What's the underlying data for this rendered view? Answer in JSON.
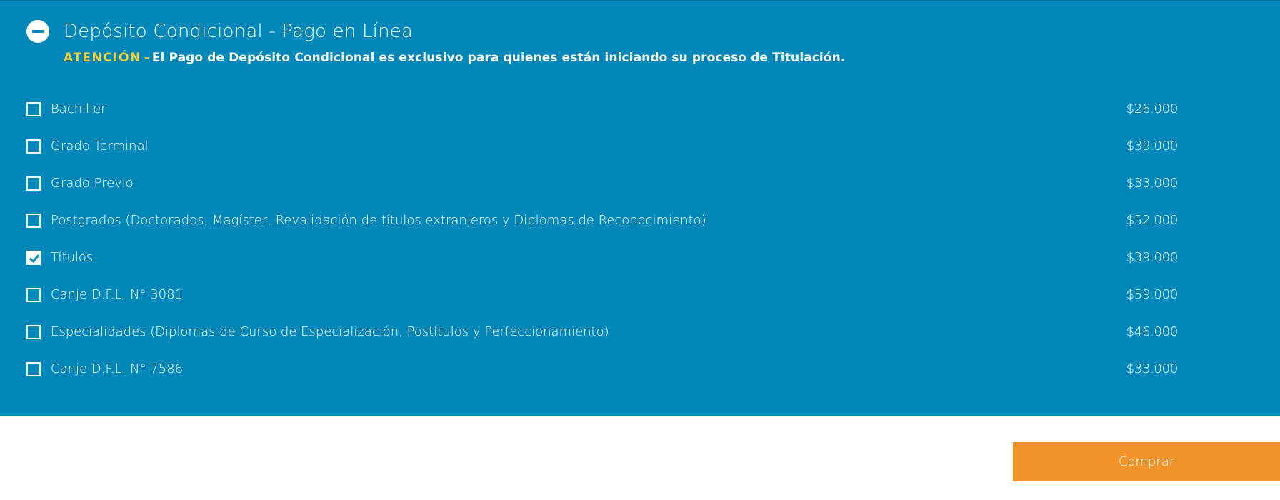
{
  "section": {
    "title": "Depósito Condicional - Pago en Línea",
    "toggle_icon": "minus-circle-icon",
    "notice": {
      "label": "ATENCIÓN",
      "separator": "-",
      "message": "El Pago de Depósito Condicional es exclusivo para quienes están iniciando su proceso de Titulación."
    }
  },
  "options": [
    {
      "label": "Bachiller",
      "price": "$26.000",
      "checked": false
    },
    {
      "label": "Grado Terminal",
      "price": "$39.000",
      "checked": false
    },
    {
      "label": "Grado Previo",
      "price": "$33.000",
      "checked": false
    },
    {
      "label": "Postgrados (Doctorados, Magíster, Revalidación de títulos extranjeros y Diplomas de Reconocimiento)",
      "price": "$52.000",
      "checked": false
    },
    {
      "label": "Títulos",
      "price": "$39.000",
      "checked": true
    },
    {
      "label": "Canje D.F.L. N° 3081",
      "price": "$59.000",
      "checked": false
    },
    {
      "label": "Especialidades (Diplomas de Curso de Especialización, Postítulos y Perfeccionamiento)",
      "price": "$46.000",
      "checked": false
    },
    {
      "label": "Canje D.F.L. N° 7586",
      "price": "$33.000",
      "checked": false
    }
  ],
  "buy_button": {
    "label": "Comprar"
  },
  "colors": {
    "panel_background": "#0087b9",
    "notice_accent": "#f4d23f",
    "button_background": "#f29429"
  }
}
